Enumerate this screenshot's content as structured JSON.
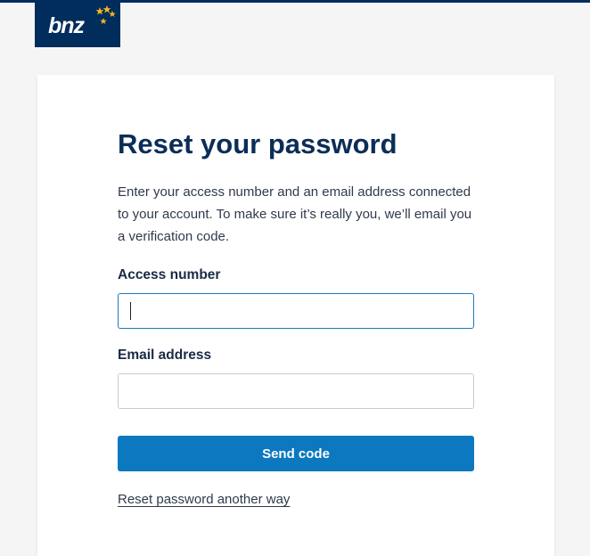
{
  "brand": {
    "logo_text": "bnz",
    "primary_color": "#002d5c",
    "accent_color": "#f5b81c",
    "button_color": "#0b78bf"
  },
  "form": {
    "title": "Reset your password",
    "intro": "Enter your access number and an email address connected to your account. To make sure it’s really you, we’ll email you a verification code.",
    "access_number": {
      "label": "Access number",
      "value": "",
      "placeholder": ""
    },
    "email_address": {
      "label": "Email address",
      "value": "",
      "placeholder": ""
    },
    "send_button_label": "Send code",
    "alternative_link": "Reset password another way"
  }
}
